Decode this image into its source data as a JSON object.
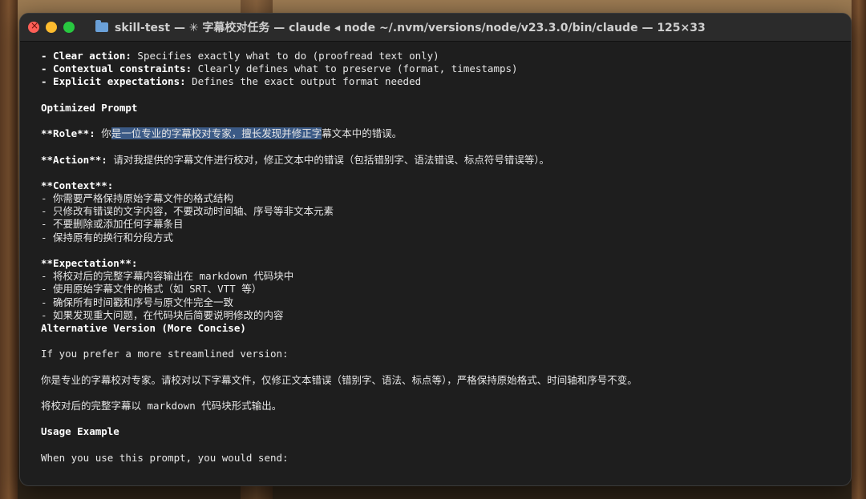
{
  "window": {
    "title": "skill-test — ✳ 字幕校对任务 — claude ◂ node ~/.nvm/versions/node/v23.3.0/bin/claude — 125×33"
  },
  "colors": {
    "selection": "#3b5a86",
    "text": "#e6e6e6",
    "background": "#1e1e1e"
  },
  "lines": {
    "l1b": "- Clear action:",
    "l1t": " Specifies exactly what to do (proofread text only)",
    "l2b": "- Contextual constraints:",
    "l2t": " Clearly defines what to preserve (format, timestamps)",
    "l3b": "- Explicit expectations:",
    "l3t": " Defines the exact output format needed",
    "h1": "Optimized Prompt",
    "role_b": "**Role**:",
    "role_t1": " 你",
    "role_sel": "是一位专业的字幕校对专家，擅长发现并修正字",
    "role_t2": "幕文本中的错误。",
    "action_b": "**Action**:",
    "action_t": " 请对我提供的字幕文件进行校对，修正文本中的错误（包括错别字、语法错误、标点符号错误等）。",
    "context_b": "**Context**:",
    "c1": "- 你需要严格保持原始字幕文件的格式结构",
    "c2": "- 只修改有错误的文字内容，不要改动时间轴、序号等非文本元素",
    "c3": "- 不要删除或添加任何字幕条目",
    "c4": "- 保持原有的换行和分段方式",
    "exp_b": "**Expectation**:",
    "e1": "- 将校对后的完整字幕内容输出在 markdown 代码块中",
    "e2": "- 使用原始字幕文件的格式（如 SRT、VTT 等）",
    "e3": "- 确保所有时间戳和序号与原文件完全一致",
    "e4": "- 如果发现重大问题，在代码块后简要说明修改的内容",
    "h2": "Alternative Version (More Concise)",
    "p1": "If you prefer a more streamlined version:",
    "p2": "你是专业的字幕校对专家。请校对以下字幕文件，仅修正文本错误（错别字、语法、标点等），严格保持原始格式、时间轴和序号不变。",
    "p3": "将校对后的完整字幕以 markdown 代码块形式输出。",
    "h3": "Usage Example",
    "p4": "When you use this prompt, you would send:"
  }
}
